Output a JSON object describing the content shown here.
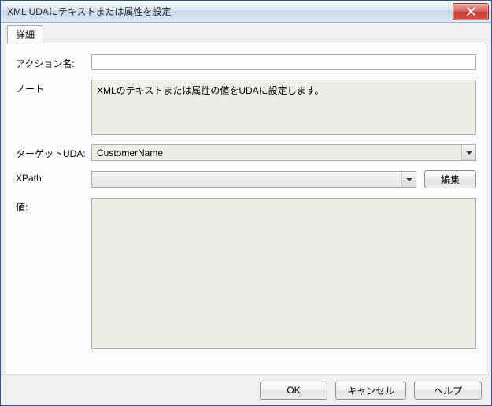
{
  "window": {
    "title": "XML UDAにテキストまたは属性を設定"
  },
  "tabs": {
    "detail": "詳細"
  },
  "labels": {
    "action_name": "アクション名:",
    "note": "ノート",
    "target_uda": "ターゲットUDA:",
    "xpath": "XPath:",
    "value": "値:"
  },
  "fields": {
    "action_name_value": "",
    "note_value": "XMLのテキストまたは属性の値をUDAに設定します。",
    "target_uda_selected": "CustomerName",
    "xpath_selected": "",
    "value_value": ""
  },
  "buttons": {
    "edit": "編集",
    "ok": "OK",
    "cancel": "キャンセル",
    "help": "ヘルプ"
  }
}
